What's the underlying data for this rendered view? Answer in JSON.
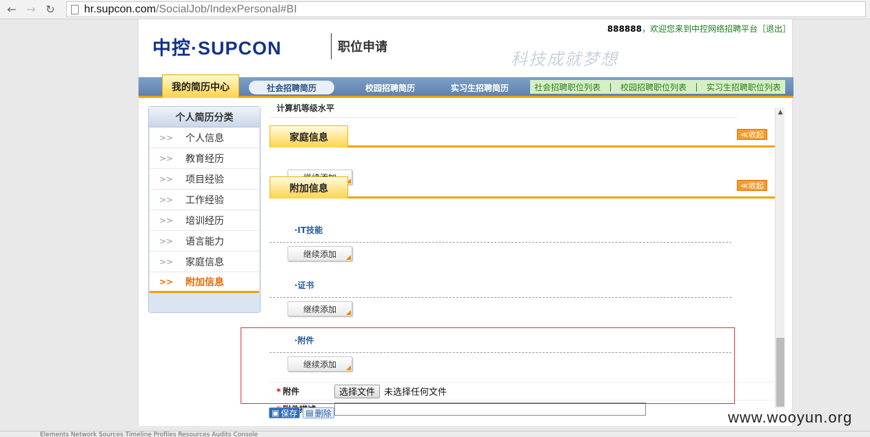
{
  "browser": {
    "url_host": "hr.supcon.com",
    "url_path": "/SocialJob/IndexPersonal#BI"
  },
  "header": {
    "logo_text": "中控·SUPCON",
    "apply_title": "职位申请",
    "welcome_user": "888888",
    "welcome_text": "，欢迎您来到中控网络招聘平台［退出］",
    "slogan": "科技成就梦想"
  },
  "nav": {
    "active_tab": "我的简历中心",
    "tabs": [
      "社会招聘简历",
      "校园招聘简历",
      "实习生招聘简历"
    ],
    "job_links": [
      "社会招聘职位列表",
      "|",
      "校园招聘职位列表",
      "|",
      "实习生招聘职位列表"
    ]
  },
  "sidebar": {
    "title": "个人简历分类",
    "arrow": ">>",
    "items": [
      {
        "label": "个人信息"
      },
      {
        "label": "教育经历"
      },
      {
        "label": "项目经验"
      },
      {
        "label": "工作经验"
      },
      {
        "label": "培训经历"
      },
      {
        "label": "语言能力"
      },
      {
        "label": "家庭信息"
      },
      {
        "label": "附加信息"
      }
    ]
  },
  "content": {
    "cut_text": "计算机等级水平",
    "collapse_label": "≪收起",
    "add_label": "继续添加",
    "family_section": "家庭信息",
    "extra_section": "附加信息",
    "sub_it": "·IT技能",
    "sub_cert": "·证书",
    "sub_attach": "·附件",
    "attach_label": "附件",
    "attach_desc_label": "附件描述",
    "file_button": "选择文件",
    "file_none": "未选择任何文件",
    "required_mark": "*"
  },
  "footer": {
    "save_label": "保存",
    "delete_label": "删除",
    "watermark": "www.wooyun.org"
  },
  "devtools": {
    "tabs": "Elements  Network  Sources  Timeline  Profiles  Resources  Audits  Console"
  }
}
